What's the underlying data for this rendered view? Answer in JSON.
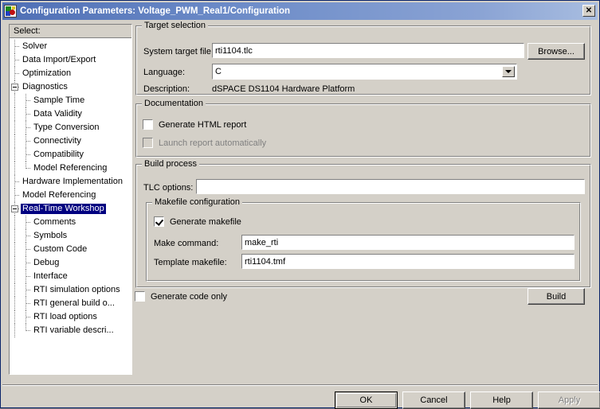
{
  "window": {
    "title": "Configuration Parameters: Voltage_PWM_Real1/Configuration",
    "icon": "simulink-model-icon",
    "close_label": "✕"
  },
  "sidebar": {
    "header": "Select:",
    "items": [
      {
        "label": "Solver",
        "level": 1,
        "expander": false,
        "selected": false
      },
      {
        "label": "Data Import/Export",
        "level": 1,
        "expander": false,
        "selected": false
      },
      {
        "label": "Optimization",
        "level": 1,
        "expander": false,
        "selected": false
      },
      {
        "label": "Diagnostics",
        "level": 1,
        "expander": true,
        "selected": false
      },
      {
        "label": "Sample Time",
        "level": 2,
        "expander": false,
        "selected": false
      },
      {
        "label": "Data Validity",
        "level": 2,
        "expander": false,
        "selected": false
      },
      {
        "label": "Type Conversion",
        "level": 2,
        "expander": false,
        "selected": false
      },
      {
        "label": "Connectivity",
        "level": 2,
        "expander": false,
        "selected": false
      },
      {
        "label": "Compatibility",
        "level": 2,
        "expander": false,
        "selected": false
      },
      {
        "label": "Model Referencing",
        "level": 2,
        "expander": false,
        "selected": false
      },
      {
        "label": "Hardware Implementation",
        "level": 1,
        "expander": false,
        "selected": false
      },
      {
        "label": "Model Referencing",
        "level": 1,
        "expander": false,
        "selected": false
      },
      {
        "label": "Real-Time Workshop",
        "level": 1,
        "expander": true,
        "selected": true
      },
      {
        "label": "Comments",
        "level": 2,
        "expander": false,
        "selected": false
      },
      {
        "label": "Symbols",
        "level": 2,
        "expander": false,
        "selected": false
      },
      {
        "label": "Custom Code",
        "level": 2,
        "expander": false,
        "selected": false
      },
      {
        "label": "Debug",
        "level": 2,
        "expander": false,
        "selected": false
      },
      {
        "label": "Interface",
        "level": 2,
        "expander": false,
        "selected": false
      },
      {
        "label": "RTI simulation options",
        "level": 2,
        "expander": false,
        "selected": false
      },
      {
        "label": "RTI general build o...",
        "level": 2,
        "expander": false,
        "selected": false
      },
      {
        "label": "RTI load options",
        "level": 2,
        "expander": false,
        "selected": false
      },
      {
        "label": "RTI variable descri...",
        "level": 2,
        "expander": false,
        "selected": false
      }
    ]
  },
  "target_selection": {
    "group_title": "Target selection",
    "system_target_file_label": "System target file:",
    "system_target_file_value": "rti1104.tlc",
    "browse_label": "Browse...",
    "language_label": "Language:",
    "language_value": "C",
    "description_label": "Description:",
    "description_value": "dSPACE DS1104 Hardware Platform"
  },
  "documentation": {
    "group_title": "Documentation",
    "generate_html_report_label": "Generate HTML report",
    "generate_html_report_checked": false,
    "launch_report_label": "Launch report automatically",
    "launch_report_checked": false,
    "launch_report_disabled": true
  },
  "build_process": {
    "group_title": "Build process",
    "tlc_options_label": "TLC options:",
    "tlc_options_value": "",
    "makefile_group_title": "Makefile configuration",
    "generate_makefile_label": "Generate makefile",
    "generate_makefile_checked": true,
    "make_command_label": "Make command:",
    "make_command_value": "make_rti",
    "template_makefile_label": "Template makefile:",
    "template_makefile_value": "rti1104.tmf"
  },
  "actions": {
    "generate_code_only_label": "Generate code only",
    "generate_code_only_checked": false,
    "build_label": "Build"
  },
  "footer": {
    "ok_label": "OK",
    "cancel_label": "Cancel",
    "help_label": "Help",
    "apply_label": "Apply",
    "apply_disabled": true
  },
  "colors": {
    "dialog_face": "#d4d0c8",
    "titlebar_blue": "#6d8cc8",
    "selection_navy": "#000080",
    "field_white": "#ffffff",
    "disabled_gray": "#808080"
  }
}
